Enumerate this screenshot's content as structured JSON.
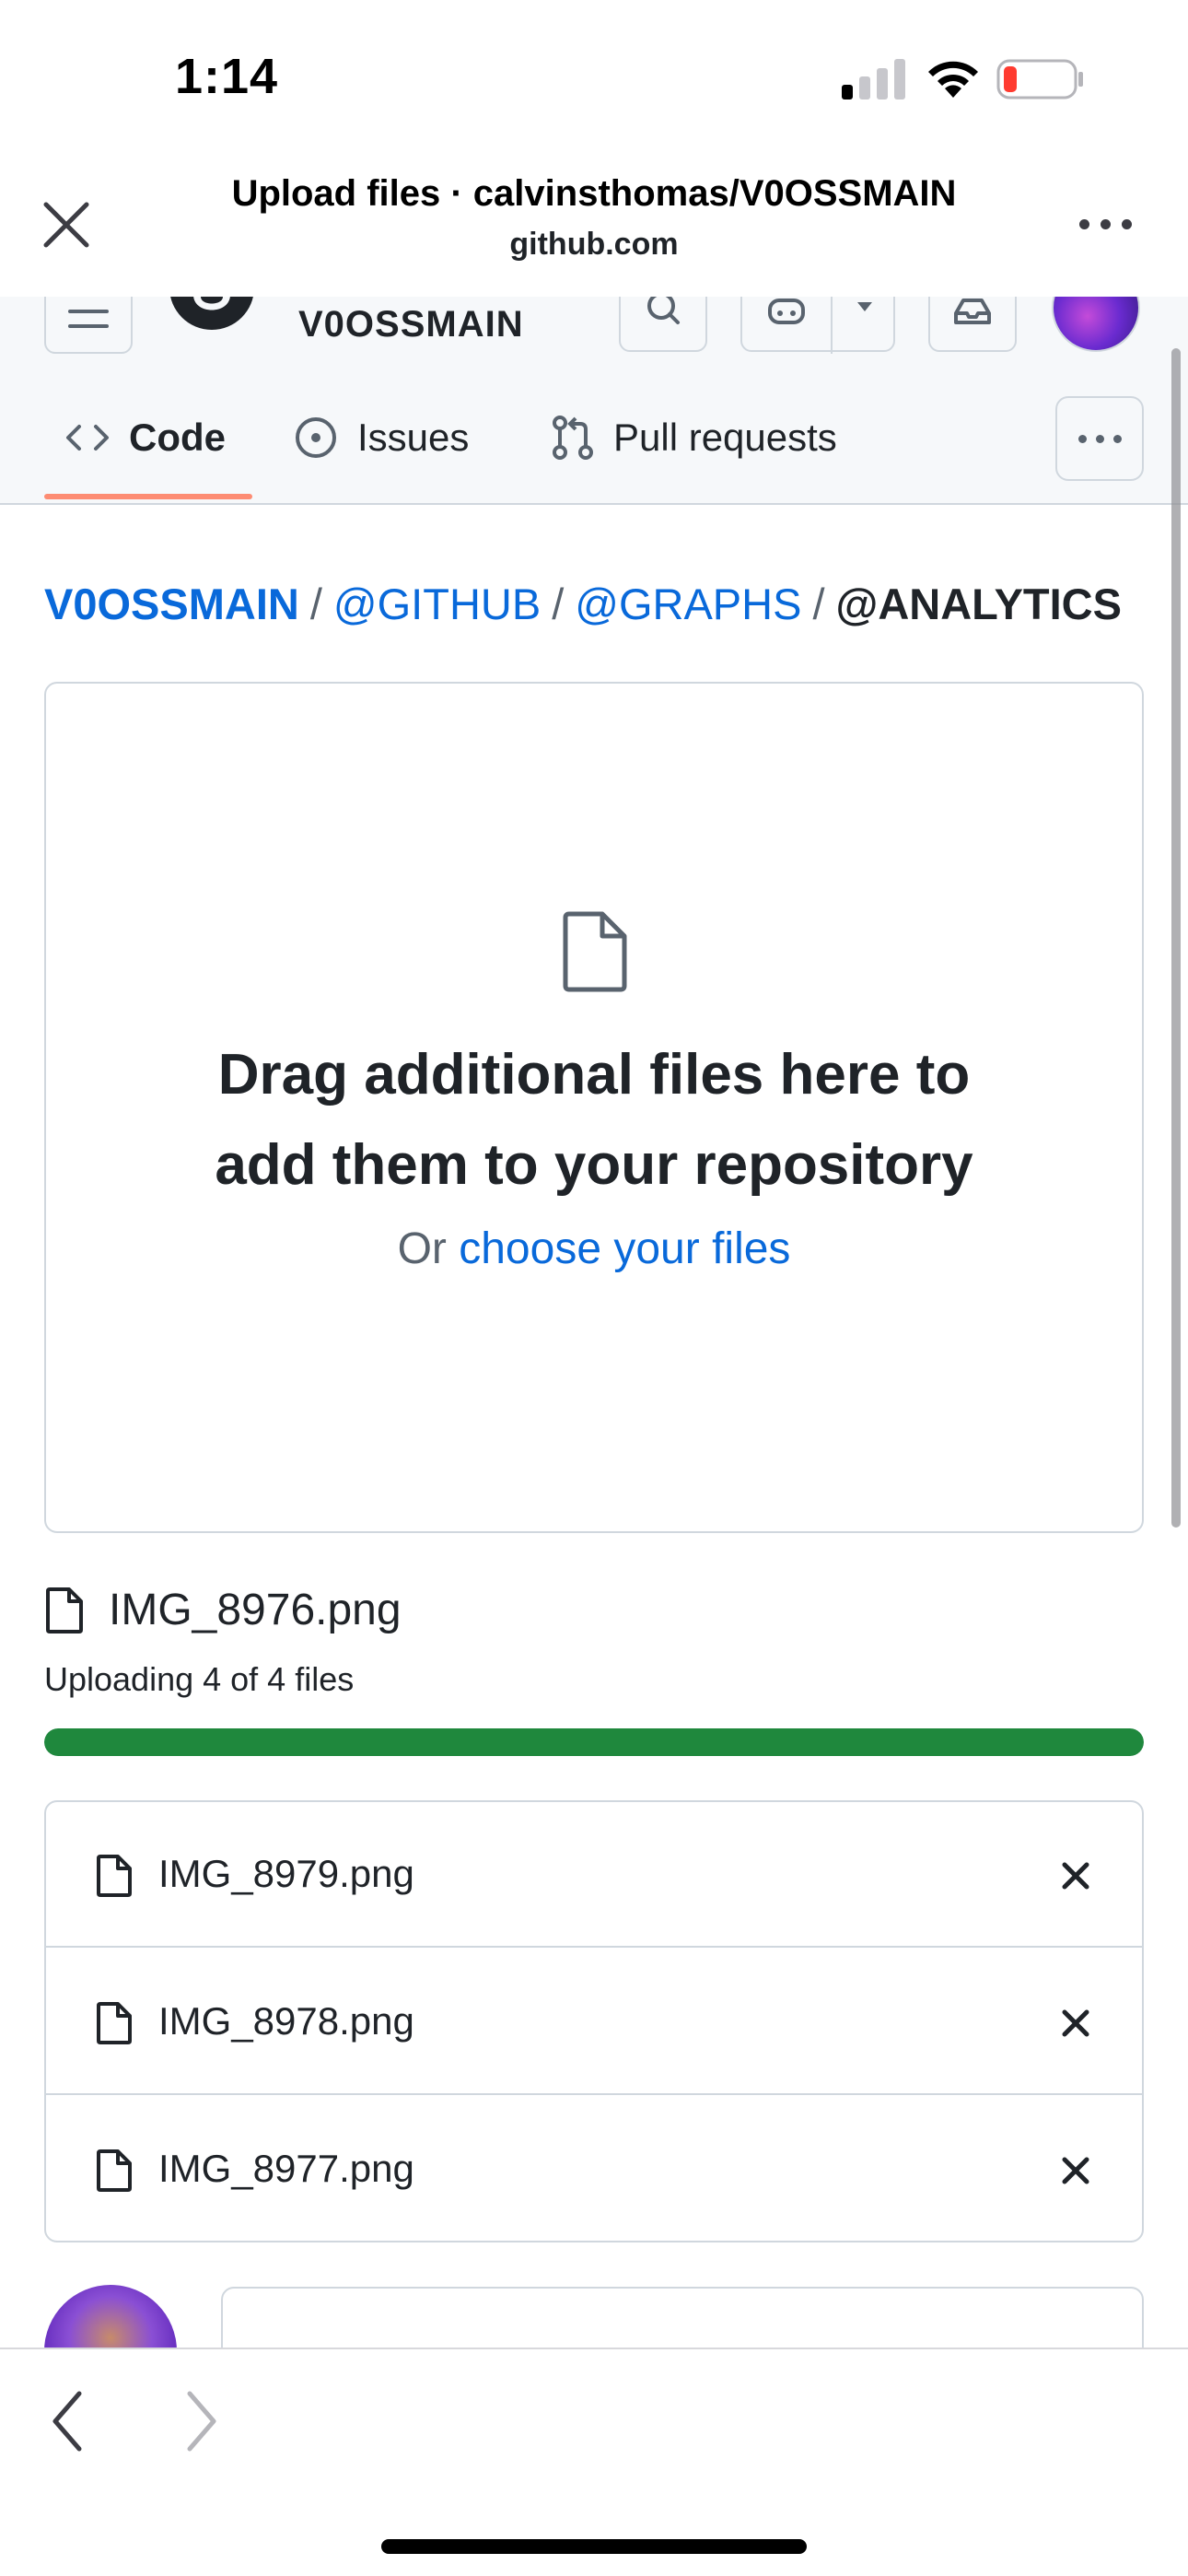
{
  "status_bar": {
    "time": "1:14"
  },
  "webview_header": {
    "title": "Upload files · calvinsthomas/V0OSSMAIN",
    "domain": "github.com"
  },
  "repo_header": {
    "repo_name": "V0OSSMAIN"
  },
  "tabs": [
    {
      "label": "Code",
      "icon": "code-icon",
      "selected": true
    },
    {
      "label": "Issues",
      "icon": "issue-opened-icon",
      "selected": false
    },
    {
      "label": "Pull requests",
      "icon": "git-pull-request-icon",
      "selected": false
    }
  ],
  "breadcrumb": {
    "root": "V0OSSMAIN",
    "parts": [
      "@GITHUB",
      "@GRAPHS"
    ],
    "current": "@ANALYTICS"
  },
  "drop_zone": {
    "heading_line1": "Drag additional files here to",
    "heading_line2": "add them to your repository",
    "subtext_prefix": "Or",
    "choose_link": "choose your files"
  },
  "upload": {
    "current_file": "IMG_8976.png",
    "status_text": "Uploading 4 of 4 files",
    "progress": 1.0
  },
  "files": [
    {
      "name": "IMG_8979.png"
    },
    {
      "name": "IMG_8978.png"
    },
    {
      "name": "IMG_8977.png"
    }
  ],
  "colors": {
    "accent_link": "#0969da",
    "progress_green": "#1f883d",
    "tab_underline": "#fd8c73",
    "border": "#d0d7de"
  }
}
